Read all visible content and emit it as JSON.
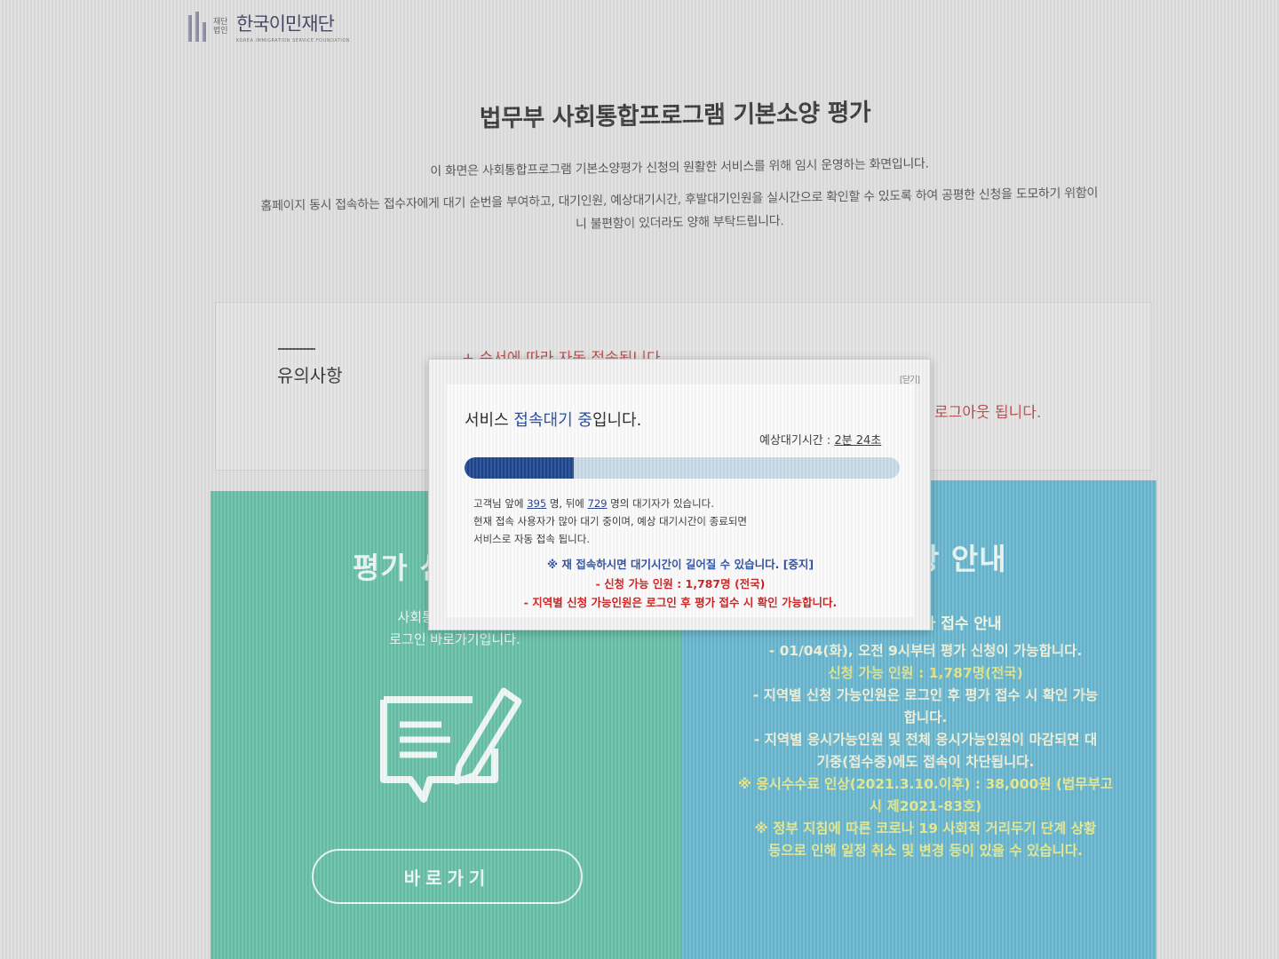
{
  "logo": {
    "small_text": "재단 법인",
    "name": "한국이민재단",
    "english": "KOREA IMMIGRATION SERVICE FOUNDATION"
  },
  "page": {
    "title": "법무부 사회통합프로그램 기본소양 평가",
    "intro_line1": "이 화면은 사회통합프로그램 기본소양평가 신청의 원활한 서비스를 위해 임시 운영하는 화면입니다.",
    "intro_line2": "홈페이지 동시 접속하는 접수자에게 대기 순번을 부여하고, 대기인원, 예상대기시간, 후발대기인원을 실시간으로 확인할 수 있도록 하여 공평한 신청을 도모하기 위함이",
    "intro_line3": "니 불편함이 있더라도 양해 부탁드립니다."
  },
  "notice": {
    "title": "유의사항",
    "line1": "+ 순서에 따라 자동 접속됩니다.",
    "line2": "로그아웃 됩니다."
  },
  "apply_card": {
    "heading": "평가 신",
    "desc_line1": "사회통합프로그램 기",
    "desc_line2": "로그인 바로가기입니다.",
    "button_label": "바로가기",
    "icon": "document-pen-icon",
    "color": "#66bfa6"
  },
  "info_card": {
    "heading": "항 안내",
    "subheading": "평가 접수 안내",
    "lines": [
      "- 01/04(화), 오전 9시부터 평가 신청이 가능합니다.",
      "신청 가능 인원 : 1,787명(전국)",
      "- 지역별 신청 가능인원은 로그인 후 평가 접수 시 확인 가능",
      "합니다.",
      "- 지역별 응시가능인원 및 전체 응시가능인원이 마감되면 대",
      "기중(접수중)에도 접속이 차단됩니다.",
      "※ 응시수수료 인상(2021.3.10.이후) : 38,000원 (법무부고",
      "시 제2021-83호)",
      "※ 정부 지침에 따른 코로나 19 사회적 거리두기 단계 상황",
      "등으로 인해 일정 취소 및 변경 등이 있을 수 있습니다."
    ],
    "color": "#68b6cf"
  },
  "modal": {
    "close_label": "[닫기]",
    "title_prefix": "서비스 ",
    "title_highlight": "접속대기 중",
    "title_suffix": "입니다.",
    "eta_label": "예상대기시간 : ",
    "eta_value": "2분 24초",
    "progress": 0.25,
    "queue_prefix": "고객님 앞에 ",
    "ahead": "395",
    "queue_mid": " 명, 뒤에 ",
    "behind": "729",
    "queue_suffix": " 명의 대기자가 있습니다.",
    "queue_line2": "현재 접속 사용자가 많아 대기 중이며, 예상 대기시간이 종료되면",
    "queue_line3": "서비스로 자동 접속 됩니다.",
    "warn_reconnect": "※ 재 접속하시면 대기시간이 길어질 수 있습니다. [중지]",
    "warn_capacity": "- 신청 가능 인원 : 1,787명 (전국)",
    "warn_region": "- 지역별 신청 가능인원은 로그인 후 평가 접수 시 확인 가능합니다.",
    "accent": "#1e4590"
  }
}
